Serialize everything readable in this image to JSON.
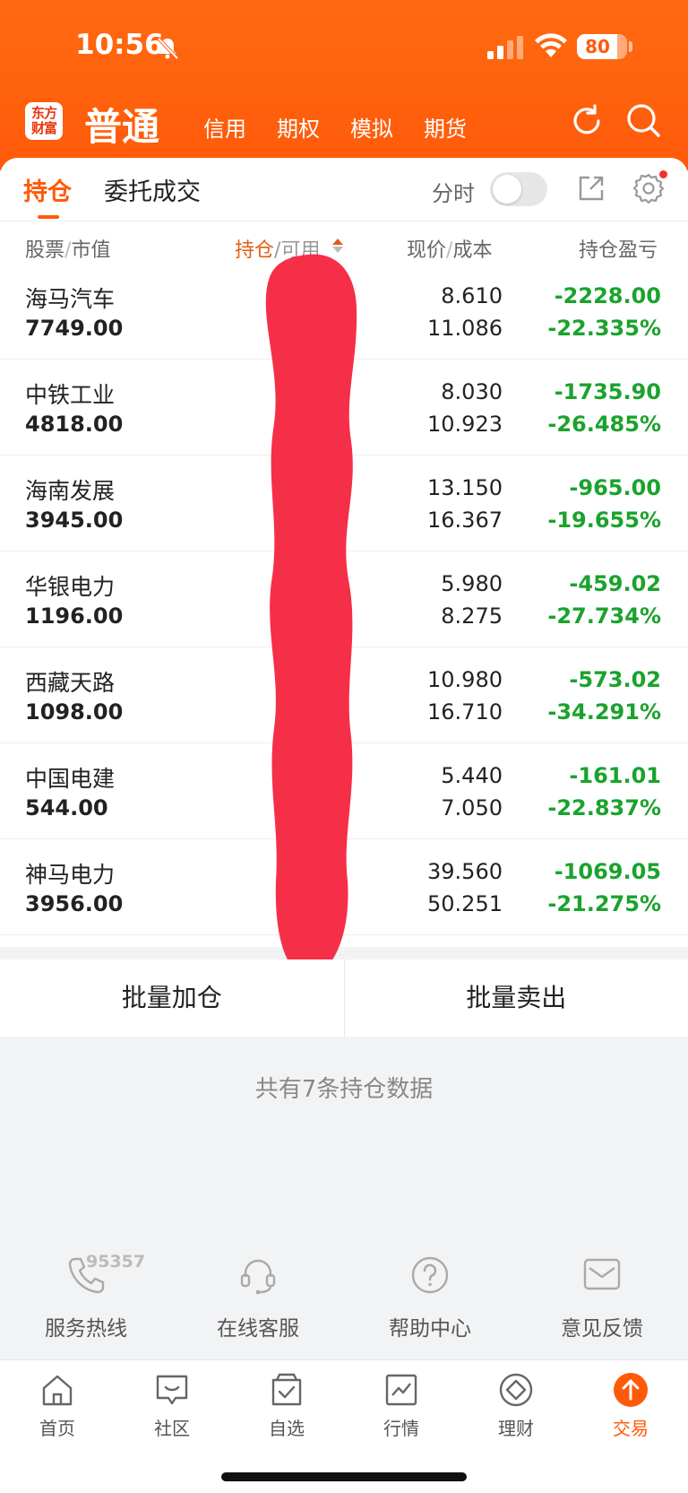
{
  "status_bar": {
    "time": "10:56",
    "battery": "80"
  },
  "header": {
    "logo_line1": "东方",
    "logo_line2": "财富",
    "mode_title": "普通",
    "mode_tabs": [
      "信用",
      "期权",
      "模拟",
      "期货"
    ]
  },
  "position_tabs": {
    "holdings": "持仓",
    "orders": "委托成交"
  },
  "timeshare_label": "分时",
  "columns": {
    "stock": "股票",
    "market_value": "市值",
    "position": "持仓",
    "available": "可用",
    "price": "现价",
    "cost": "成本",
    "profit_loss": "持仓盈亏",
    "separator": "/"
  },
  "holdings": [
    {
      "name": "海马汽车",
      "market_value": "7749.00",
      "price": "8.610",
      "cost": "11.086",
      "pl": "-2228.00",
      "pl_pct": "-22.335%"
    },
    {
      "name": "中铁工业",
      "market_value": "4818.00",
      "price": "8.030",
      "cost": "10.923",
      "pl": "-1735.90",
      "pl_pct": "-26.485%"
    },
    {
      "name": "海南发展",
      "market_value": "3945.00",
      "price": "13.150",
      "cost": "16.367",
      "pl": "-965.00",
      "pl_pct": "-19.655%"
    },
    {
      "name": "华银电力",
      "market_value": "1196.00",
      "price": "5.980",
      "cost": "8.275",
      "pl": "-459.02",
      "pl_pct": "-27.734%"
    },
    {
      "name": "西藏天路",
      "market_value": "1098.00",
      "price": "10.980",
      "cost": "16.710",
      "pl": "-573.02",
      "pl_pct": "-34.291%"
    },
    {
      "name": "中国电建",
      "market_value": "544.00",
      "price": "5.440",
      "cost": "7.050",
      "pl": "-161.01",
      "pl_pct": "-22.837%"
    },
    {
      "name": "神马电力",
      "market_value": "3956.00",
      "price": "39.560",
      "cost": "50.251",
      "pl": "-1069.05",
      "pl_pct": "-21.275%"
    }
  ],
  "batch": {
    "add": "批量加仓",
    "sell": "批量卖出"
  },
  "summary_text": "共有7条持仓数据",
  "services": {
    "hotline_number": "95357",
    "hotline": "服务热线",
    "online": "在线客服",
    "help": "帮助中心",
    "feedback": "意见反馈"
  },
  "tabbar": [
    "首页",
    "社区",
    "自选",
    "行情",
    "理财",
    "交易"
  ],
  "colors": {
    "accent": "#ff5a0a",
    "loss": "#1aa32c",
    "redaction": "#f5243f"
  }
}
